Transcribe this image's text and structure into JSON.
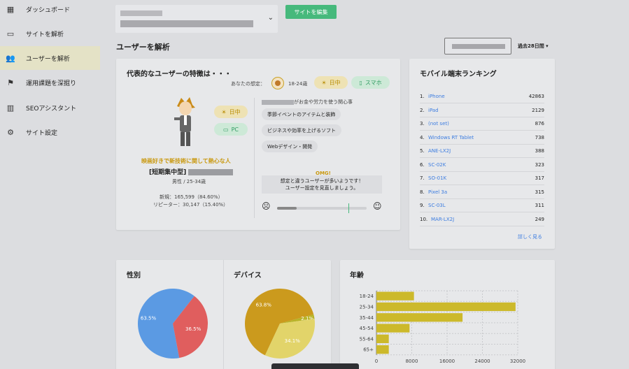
{
  "sidebar": {
    "items": [
      {
        "label": "ダッシュボード",
        "icon": "dashboard-icon"
      },
      {
        "label": "サイトを解析",
        "icon": "site-icon"
      },
      {
        "label": "ユーザーを解析",
        "icon": "users-icon"
      },
      {
        "label": "運用課題を深掘り",
        "icon": "flag-icon"
      },
      {
        "label": "SEOアシスタント",
        "icon": "chart-icon"
      },
      {
        "label": "サイト設定",
        "icon": "gear-icon"
      }
    ]
  },
  "header": {
    "edit_button": "サイトを編集",
    "page_title": "ユーザーを解析",
    "period": "過去28日間 ▾"
  },
  "persona": {
    "title": "代表的なユーザーの特徴は・・・",
    "assumption_label": "あなたの想定：",
    "assumption_age": "18-24歳",
    "assumption_time": "日中",
    "assumption_device": "スマホ",
    "time_pill": "日中",
    "device_pill": "PC",
    "headline": "映画好きで新技術に関して熱心な人",
    "segment": "[短期集中型]",
    "demographic": "男性 / 25-34歳",
    "new_users": "新規：165,599（84.60%）",
    "repeaters": "リピーター：30,147（15.40%）",
    "interest_suffix": "がお金や労力を使う関心事",
    "interests": [
      "季節イベントのアイテムと装飾",
      "ビジネスや効率を上げるソフト",
      "Webデザイン・開発"
    ],
    "omg": "OMG!",
    "mismatch_line1": "想定と違うユーザーが多いようです！",
    "mismatch_line2": "ユーザー設定を見直しましょう。",
    "match_level": 0.22
  },
  "ranking": {
    "title": "モバイル端末ランキング",
    "rows": [
      {
        "rank": "1.",
        "name": "iPhone",
        "value": "42863"
      },
      {
        "rank": "2.",
        "name": "iPad",
        "value": "2129"
      },
      {
        "rank": "3.",
        "name": "(not set)",
        "value": "876"
      },
      {
        "rank": "4.",
        "name": "Windows RT Tablet",
        "value": "738"
      },
      {
        "rank": "5.",
        "name": "ANE-LX2J",
        "value": "388"
      },
      {
        "rank": "6.",
        "name": "SC-02K",
        "value": "323"
      },
      {
        "rank": "7.",
        "name": "SO-01K",
        "value": "317"
      },
      {
        "rank": "8.",
        "name": "Pixel 3a",
        "value": "315"
      },
      {
        "rank": "9.",
        "name": "SC-03L",
        "value": "311"
      },
      {
        "rank": "10.",
        "name": "MAR-LX2J",
        "value": "249"
      }
    ],
    "more_link": "詳しく見る"
  },
  "gender": {
    "title": "性別",
    "slices": [
      {
        "label": "63.5%",
        "value": 63.5,
        "color": "#5b9ae3"
      },
      {
        "label": "36.5%",
        "value": 36.5,
        "color": "#e05e5e"
      }
    ]
  },
  "device": {
    "title": "デバイス",
    "slices": [
      {
        "label": "63.8%",
        "value": 63.8,
        "color": "#cb9a1d"
      },
      {
        "label": "2.1%",
        "value": 2.1,
        "color": "#b8b327"
      },
      {
        "label": "34.1%",
        "value": 34.1,
        "color": "#e2d46a"
      }
    ]
  },
  "chart_data": {
    "type": "bar",
    "title": "年齢",
    "categories": [
      "18-24",
      "25-34",
      "35-44",
      "45-54",
      "55-64",
      "65+"
    ],
    "values": [
      8500,
      31500,
      19500,
      7500,
      2800,
      2800
    ],
    "xlim": [
      0,
      32000
    ],
    "xticks": [
      "0",
      "8000",
      "16000",
      "24000",
      "32000"
    ],
    "color": "#ccb92b"
  }
}
